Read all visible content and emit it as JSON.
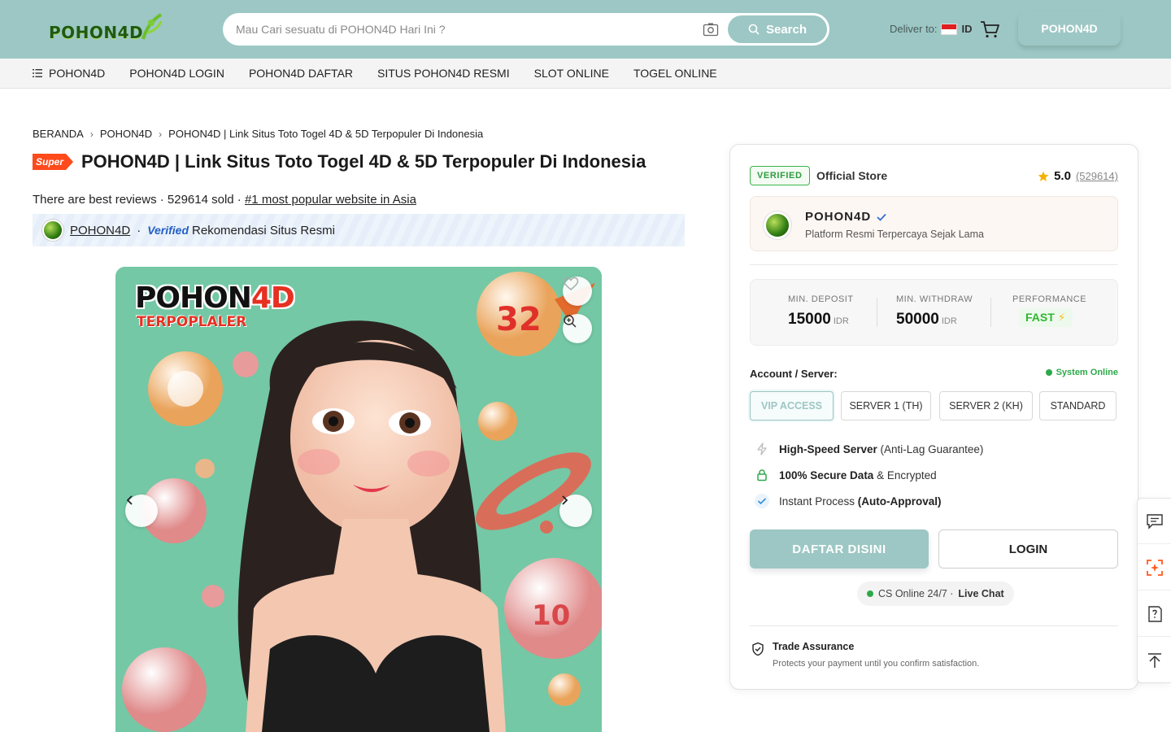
{
  "header": {
    "logo_text": "POHON4D",
    "search_placeholder": "Mau Cari sesuatu di POHON4D Hari Ini ?",
    "search_button": "Search",
    "deliver_label": "Deliver to:",
    "deliver_country": "ID",
    "cta_button": "POHON4D",
    "brand_color": "#9cc7c4"
  },
  "nav": {
    "items": [
      "POHON4D",
      "POHON4D LOGIN",
      "POHON4D DAFTAR",
      "SITUS POHON4D RESMI",
      "SLOT ONLINE",
      "TOGEL ONLINE"
    ]
  },
  "breadcrumb": [
    "BERANDA",
    "POHON4D",
    "POHON4D | Link Situs Toto Togel 4D & 5D Terpopuler Di Indonesia"
  ],
  "product": {
    "badge": "Super",
    "title": "POHON4D | Link Situs Toto Togel 4D & 5D Terpopuler Di Indonesia",
    "reviews_text": "There are best reviews · 529614 sold ·",
    "rank_text": "#1 most popular website in Asia",
    "seller_link": "POHON4D",
    "verified_tag": "Verified",
    "verified_text": "Rekomendasi Situs Resmi"
  },
  "hero": {
    "logo_main": "POHON",
    "logo_accent": "4D",
    "logo_sub": "TERPOPLALER"
  },
  "card": {
    "verified_badge": "VERIFIED",
    "official_store": "Official Store",
    "rating": "5.0",
    "rating_count": "(529614)",
    "store_name": "POHON4D",
    "store_desc": "Platform Resmi Terpercaya Sejak Lama",
    "stats": [
      {
        "label": "MIN. DEPOSIT",
        "value": "15000",
        "unit": "IDR"
      },
      {
        "label": "MIN. WITHDRAW",
        "value": "50000",
        "unit": "IDR"
      },
      {
        "label": "PERFORMANCE",
        "value": "FAST"
      }
    ],
    "account_label": "Account / Server:",
    "system_status": "System Online",
    "servers": [
      "VIP ACCESS",
      "SERVER 1 (TH)",
      "SERVER 2 (KH)",
      "STANDARD"
    ],
    "features": [
      {
        "bold": "High-Speed Server",
        "rest": " (Anti-Lag Guarantee)"
      },
      {
        "bold": "100% Secure Data",
        "rest": " & Encrypted"
      },
      {
        "pre": "Instant Process ",
        "bold": "(Auto-Approval)"
      }
    ],
    "daftar_button": "DAFTAR DISINI",
    "login_button": "LOGIN",
    "cs_text": "CS Online 24/7 ·",
    "cs_link": "Live Chat",
    "trade_title": "Trade Assurance",
    "trade_desc": "Protects your payment until you confirm satisfaction."
  }
}
